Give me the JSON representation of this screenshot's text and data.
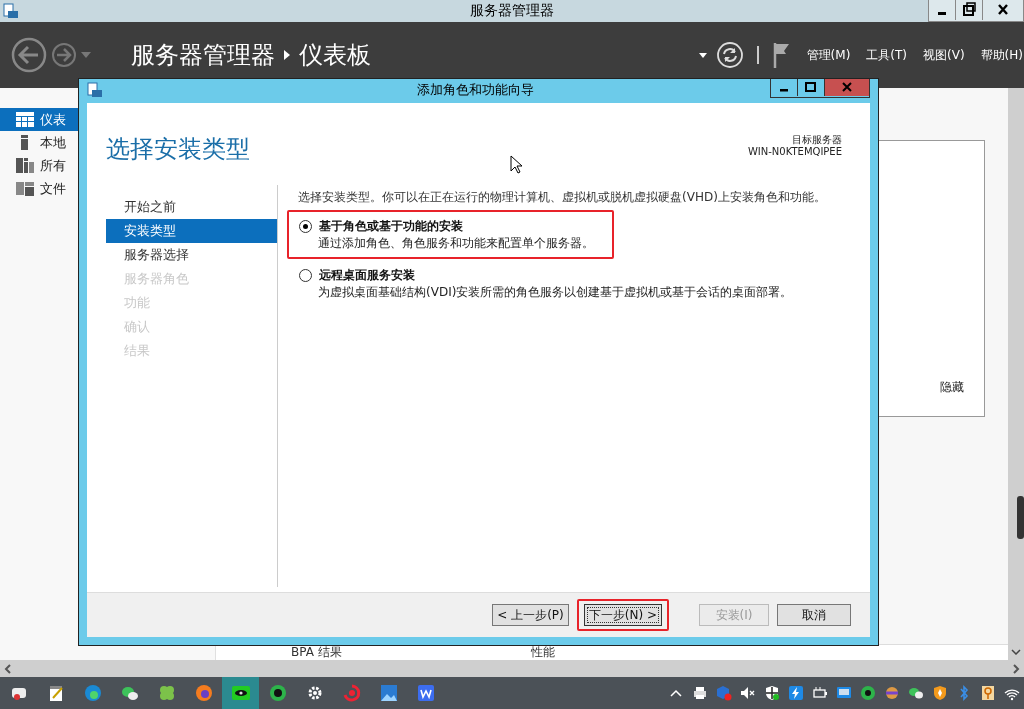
{
  "window": {
    "title": "服务器管理器"
  },
  "header": {
    "breadcrumb": "服务器管理器",
    "page": "仪表板",
    "menus": [
      "管理(M)",
      "工具(T)",
      "视图(V)",
      "帮助(H)"
    ]
  },
  "sidebar": {
    "items": [
      {
        "label": "仪表",
        "selected": true
      },
      {
        "label": "本地",
        "selected": false
      },
      {
        "label": "所有",
        "selected": false
      },
      {
        "label": "文件",
        "selected": false
      }
    ]
  },
  "panel": {
    "hide_link": "隐藏"
  },
  "table_strip": [
    "BPA 结果",
    "性能"
  ],
  "dialog": {
    "title": "添加角色和功能向导",
    "heading": "选择安装类型",
    "target_label": "目标服务器",
    "target_server": "WIN-N0KTEMQIPEE",
    "steps": [
      {
        "label": "开始之前",
        "selected": false,
        "disabled": false
      },
      {
        "label": "安装类型",
        "selected": true,
        "disabled": false
      },
      {
        "label": "服务器选择",
        "selected": false,
        "disabled": false
      },
      {
        "label": "服务器角色",
        "selected": false,
        "disabled": true
      },
      {
        "label": "功能",
        "selected": false,
        "disabled": true
      },
      {
        "label": "确认",
        "selected": false,
        "disabled": true
      },
      {
        "label": "结果",
        "selected": false,
        "disabled": true
      }
    ],
    "intro": "选择安装类型。你可以在正在运行的物理计算机、虚拟机或脱机虚拟硬盘(VHD)上安装角色和功能。",
    "options": [
      {
        "title": "基于角色或基于功能的安装",
        "description": "通过添加角色、角色服务和功能来配置单个服务器。",
        "selected": true,
        "highlighted": true
      },
      {
        "title": "远程桌面服务安装",
        "description": "为虚拟桌面基础结构(VDI)安装所需的角色服务以创建基于虚拟机或基于会话的桌面部署。",
        "selected": false,
        "highlighted": false
      }
    ],
    "buttons": [
      {
        "label": "< 上一步(P)",
        "disabled": false,
        "focused": false,
        "highlighted": false
      },
      {
        "label": "下一步(N) >",
        "disabled": false,
        "focused": true,
        "highlighted": true
      },
      {
        "label": "安装(I)",
        "disabled": true,
        "focused": false,
        "highlighted": false
      },
      {
        "label": "取消",
        "disabled": false,
        "focused": false,
        "highlighted": false
      }
    ]
  },
  "taskbar": {
    "apps": [
      {
        "selected": false
      },
      {
        "selected": false
      },
      {
        "selected": false
      },
      {
        "selected": false
      },
      {
        "selected": false
      },
      {
        "selected": false
      },
      {
        "selected": true
      },
      {
        "selected": false
      },
      {
        "selected": false
      },
      {
        "selected": false
      },
      {
        "selected": false
      },
      {
        "selected": false
      }
    ]
  }
}
